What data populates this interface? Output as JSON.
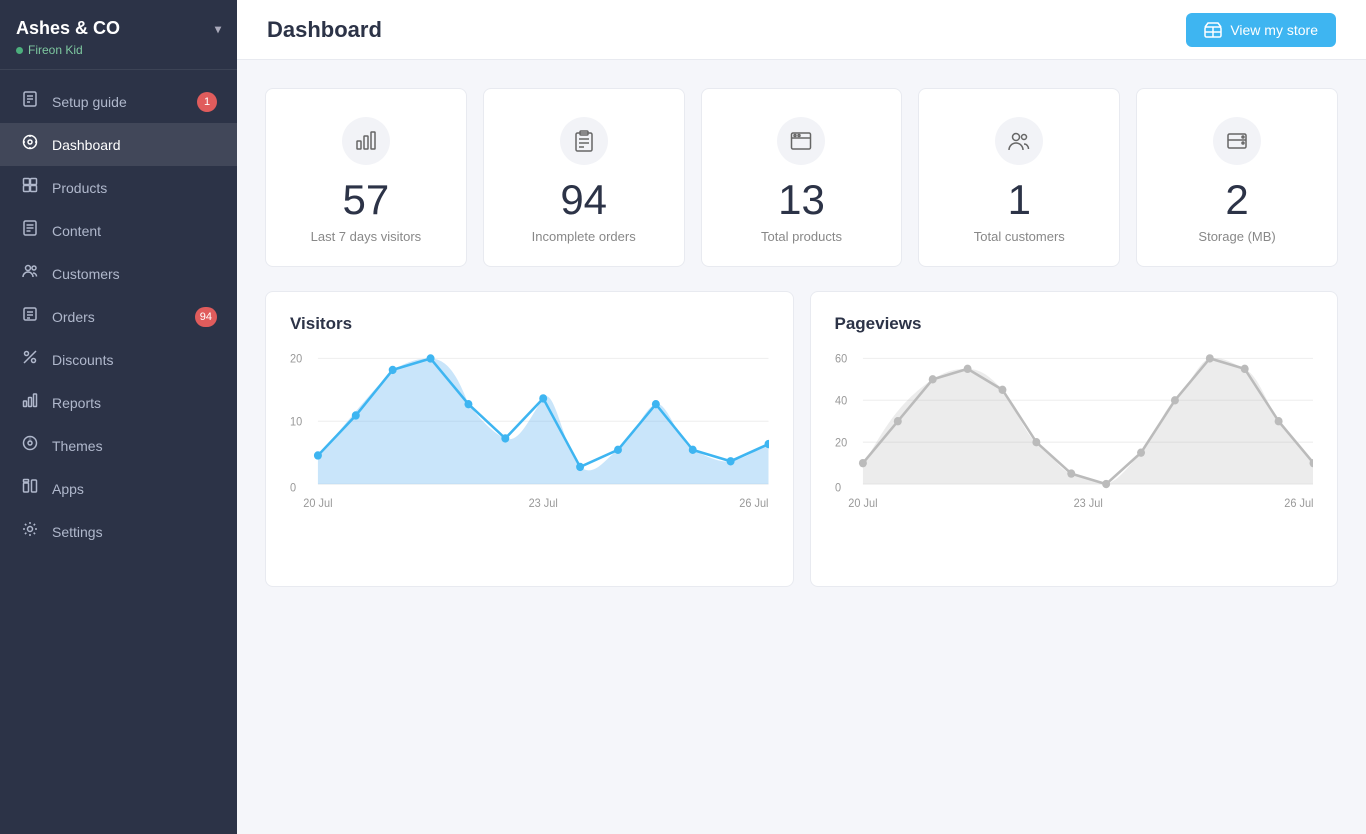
{
  "brand": {
    "name": "Ashes & CO",
    "store": "Fireon Kid"
  },
  "sidebar": {
    "items": [
      {
        "id": "setup-guide",
        "label": "Setup guide",
        "icon": "📋",
        "badge": 1
      },
      {
        "id": "dashboard",
        "label": "Dashboard",
        "icon": "⊙",
        "active": true
      },
      {
        "id": "products",
        "label": "Products",
        "icon": "📦"
      },
      {
        "id": "content",
        "label": "Content",
        "icon": "📄"
      },
      {
        "id": "customers",
        "label": "Customers",
        "icon": "👥"
      },
      {
        "id": "orders",
        "label": "Orders",
        "icon": "🗒",
        "badge": 94
      },
      {
        "id": "discounts",
        "label": "Discounts",
        "icon": "✂"
      },
      {
        "id": "reports",
        "label": "Reports",
        "icon": "📊"
      },
      {
        "id": "themes",
        "label": "Themes",
        "icon": "🎨"
      },
      {
        "id": "apps",
        "label": "Apps",
        "icon": "🎁"
      },
      {
        "id": "settings",
        "label": "Settings",
        "icon": "⚙"
      }
    ]
  },
  "header": {
    "title": "Dashboard",
    "view_store_btn": "View my store"
  },
  "stats": [
    {
      "id": "visitors",
      "number": "57",
      "label": "Last 7 days visitors",
      "icon": "bar-chart-icon"
    },
    {
      "id": "incomplete-orders",
      "number": "94",
      "label": "Incomplete orders",
      "icon": "clipboard-icon"
    },
    {
      "id": "total-products",
      "number": "13",
      "label": "Total products",
      "icon": "browser-icon"
    },
    {
      "id": "total-customers",
      "number": "1",
      "label": "Total customers",
      "icon": "users-icon"
    },
    {
      "id": "storage",
      "number": "2",
      "label": "Storage (MB)",
      "icon": "storage-icon"
    }
  ],
  "charts": {
    "visitors": {
      "title": "Visitors",
      "x_labels": [
        "20 Jul",
        "23 Jul",
        "26 Jul"
      ],
      "y_labels": [
        "20",
        "10",
        "0"
      ],
      "data": [
        5,
        12,
        20,
        22,
        14,
        8,
        15,
        3,
        6,
        14,
        6,
        4,
        7
      ]
    },
    "pageviews": {
      "title": "Pageviews",
      "x_labels": [
        "20 Jul",
        "23 Jul",
        "26 Jul"
      ],
      "y_labels": [
        "60",
        "40",
        "20",
        "0"
      ],
      "data": [
        10,
        30,
        50,
        55,
        45,
        20,
        5,
        0,
        15,
        40,
        60,
        55,
        30,
        10
      ]
    }
  }
}
